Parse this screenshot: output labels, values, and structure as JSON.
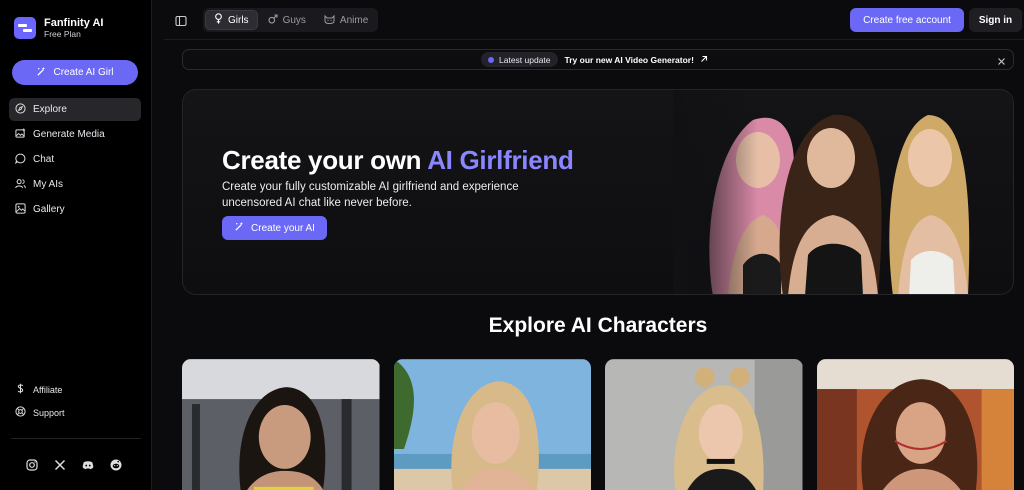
{
  "brand": {
    "name": "Fanfinity AI",
    "plan": "Free Plan"
  },
  "sidebar": {
    "create_label": "Create AI Girl",
    "items": [
      {
        "label": "Explore",
        "icon": "compass-icon",
        "active": true
      },
      {
        "label": "Generate Media",
        "icon": "image-plus-icon",
        "active": false
      },
      {
        "label": "Chat",
        "icon": "chat-icon",
        "active": false
      },
      {
        "label": "My AIs",
        "icon": "users-icon",
        "active": false
      },
      {
        "label": "Gallery",
        "icon": "gallery-icon",
        "active": false
      }
    ],
    "bottom": [
      {
        "label": "Affiliate",
        "icon": "dollar-icon"
      },
      {
        "label": "Support",
        "icon": "support-icon"
      }
    ],
    "socials": [
      "instagram-icon",
      "x-icon",
      "discord-icon",
      "reddit-icon"
    ]
  },
  "topbar": {
    "tabs": [
      {
        "label": "Girls",
        "icon": "female-icon",
        "active": true
      },
      {
        "label": "Guys",
        "icon": "male-icon",
        "active": false
      },
      {
        "label": "Anime",
        "icon": "anime-icon",
        "active": false
      }
    ],
    "create_account": "Create free account",
    "sign_in": "Sign in"
  },
  "announcement": {
    "badge": "Latest update",
    "text": "Try our new AI Video Generator!"
  },
  "hero": {
    "title_plain": "Create your own",
    "title_accent": "AI Girlfriend",
    "subtitle": "Create your fully customizable AI girlfriend and experience uncensored AI chat like never before.",
    "button": "Create your AI"
  },
  "section": {
    "title": "Explore AI Characters"
  },
  "colors": {
    "accent": "#6c68f6",
    "accent_text": "#8a86ff",
    "background": "#0b0b0d",
    "sidebar": "#000000"
  }
}
